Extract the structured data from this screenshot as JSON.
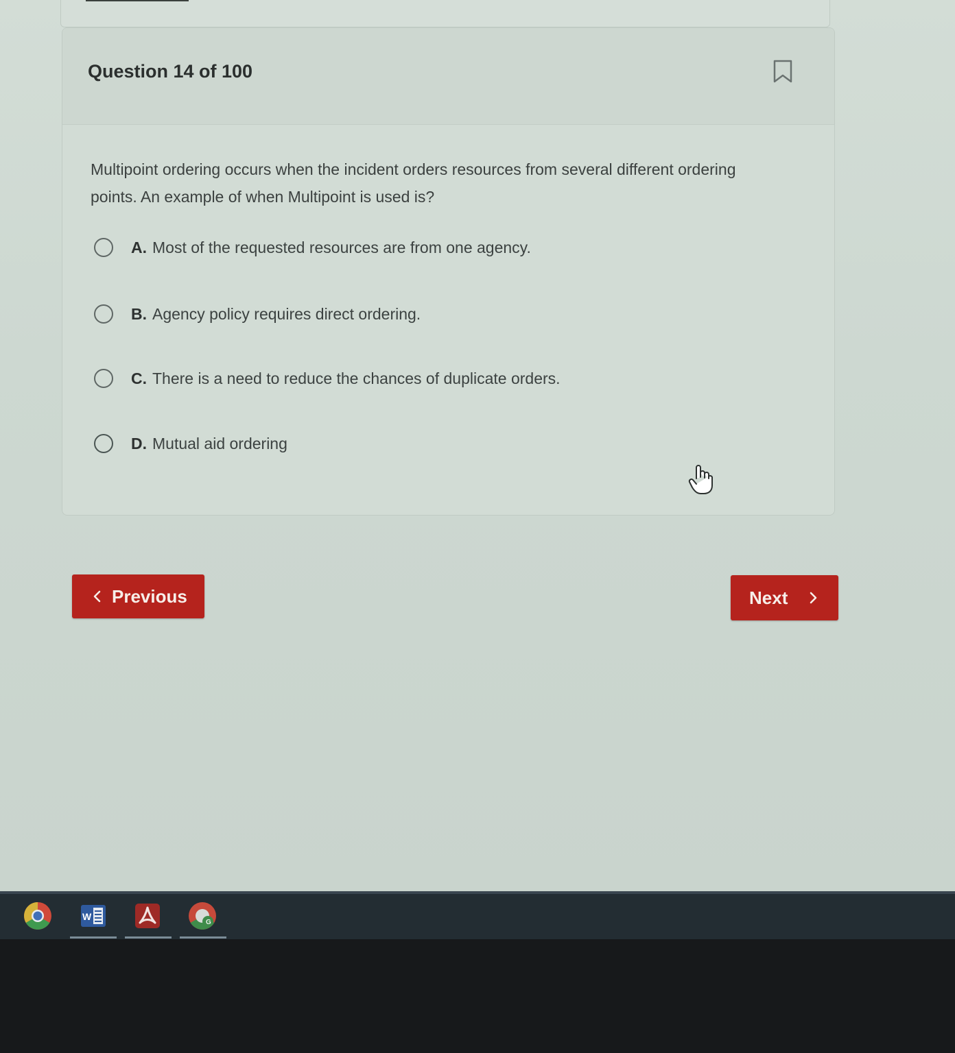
{
  "header": {
    "question_count": "Question 14 of 100",
    "bookmark_icon": "bookmark-outline-icon"
  },
  "question": {
    "text": "Multipoint ordering occurs when the incident orders resources from several different ordering points.  An example of when Multipoint is used is?"
  },
  "options": [
    {
      "letter": "A.",
      "text": "Most of the requested resources are from one agency."
    },
    {
      "letter": "B.",
      "text": "Agency policy requires direct ordering."
    },
    {
      "letter": "C.",
      "text": "There is a need to reduce the chances of duplicate orders."
    },
    {
      "letter": "D.",
      "text": "Mutual aid ordering"
    }
  ],
  "navigation": {
    "previous_label": "Previous",
    "next_label": "Next"
  },
  "taskbar": {
    "apps": [
      "chrome-icon",
      "word-icon",
      "acrobat-icon",
      "classroom-icon"
    ]
  },
  "colors": {
    "accent": "#b5231d",
    "background": "#cfd9d2",
    "taskbar": "#232d33"
  }
}
